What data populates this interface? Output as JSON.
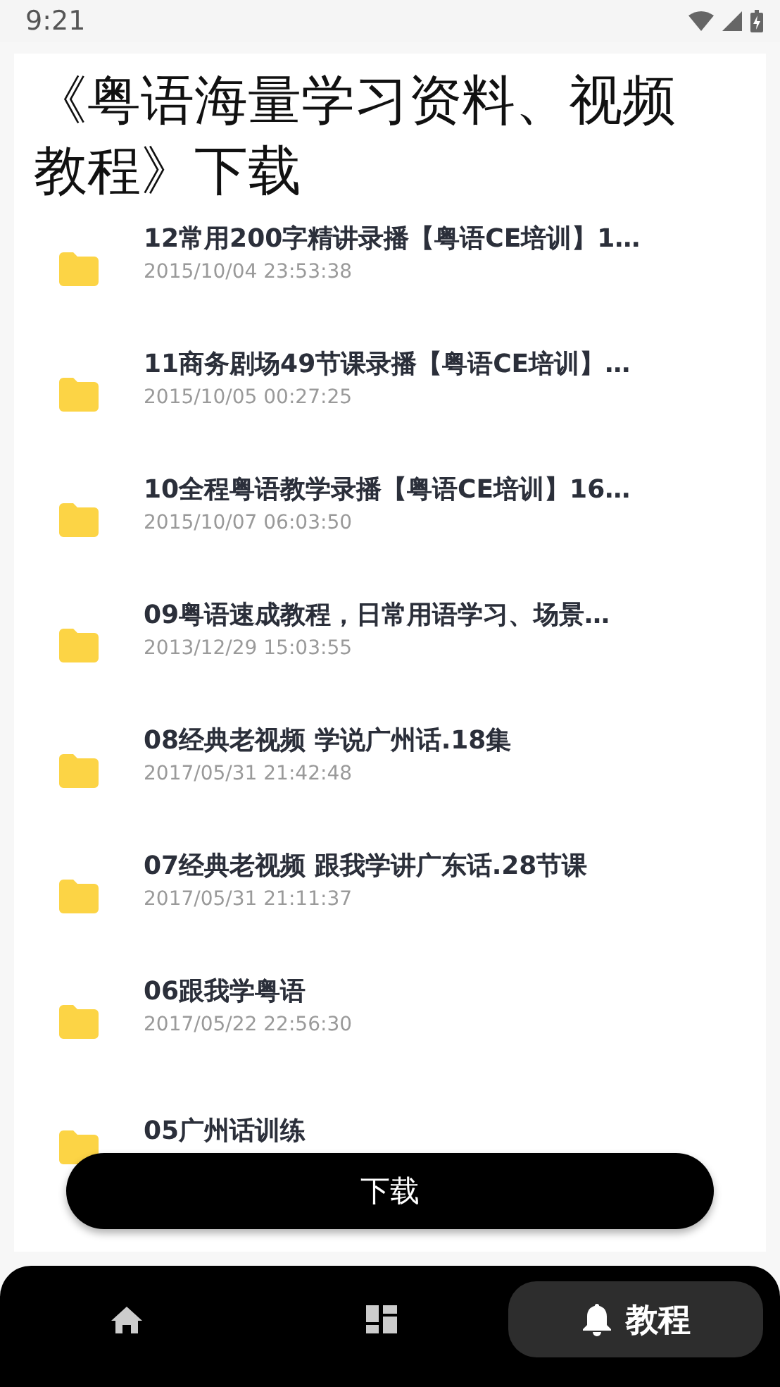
{
  "status_bar": {
    "time": "9:21"
  },
  "title": "《粤语海量学习资料、视频教程》下载",
  "files": [
    {
      "name": "12常用200字精讲录播【粤语CE培训】1…",
      "date": "2015/10/04 23:53:38"
    },
    {
      "name": "11商务剧场49节课录播【粤语CE培训】…",
      "date": "2015/10/05 00:27:25"
    },
    {
      "name": "10全程粤语教学录播【粤语CE培训】16…",
      "date": "2015/10/07 06:03:50"
    },
    {
      "name": "09粤语速成教程，日常用语学习、场景…",
      "date": "2013/12/29 15:03:55"
    },
    {
      "name": "08经典老视频 学说广州话.18集",
      "date": "2017/05/31 21:42:48"
    },
    {
      "name": "07经典老视频 跟我学讲广东话.28节课",
      "date": "2017/05/31 21:11:37"
    },
    {
      "name": "06跟我学粤语",
      "date": "2017/05/22 22:56:30"
    },
    {
      "name": "05广州话训练"
    }
  ],
  "download_button": "下载",
  "nav": [
    {
      "kind": "home",
      "selected": false
    },
    {
      "kind": "grid",
      "selected": false
    },
    {
      "kind": "bell",
      "label": "教程",
      "selected": true
    }
  ]
}
